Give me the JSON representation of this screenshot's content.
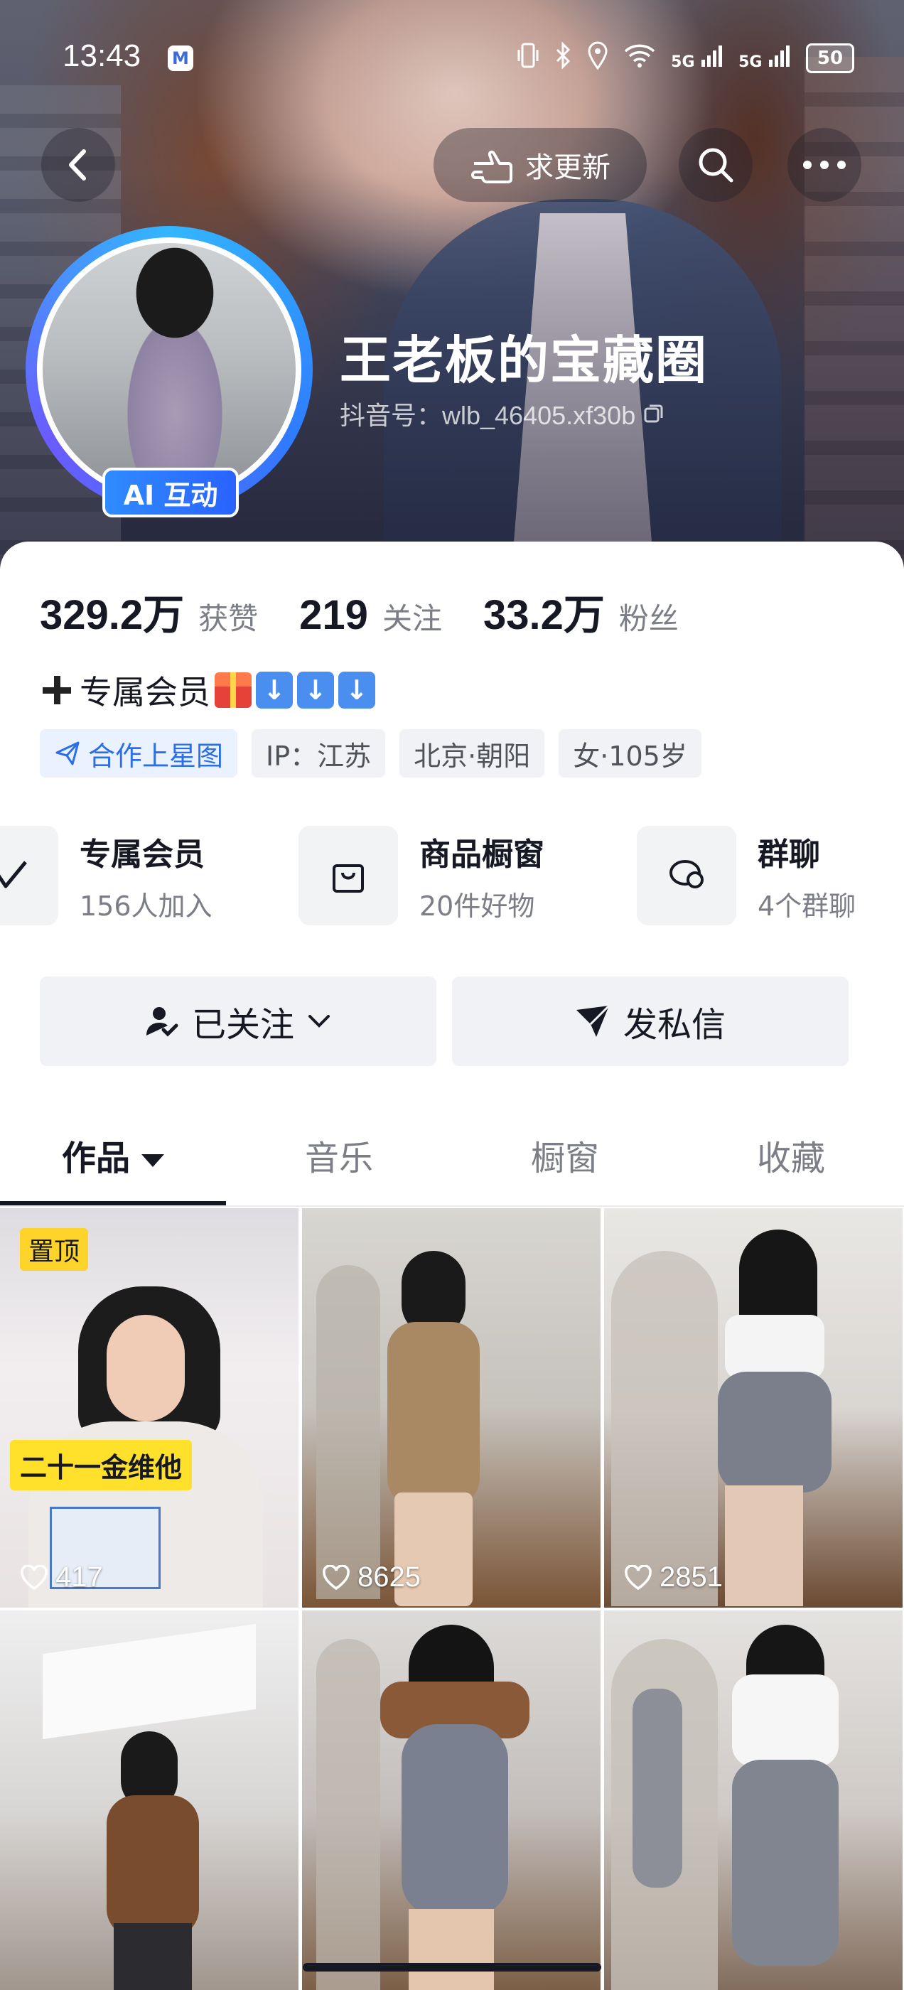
{
  "status_bar": {
    "time": "13:43",
    "app_badge": "M",
    "network_1": "5G",
    "network_2": "5G",
    "battery": "50"
  },
  "header": {
    "update_request_label": "求更新",
    "name": "王老板的宝藏圈",
    "douyin_id": "抖音号：wlb_46405.xf30b",
    "ai_badge": "AI 互动"
  },
  "stats": [
    {
      "value": "329.2万",
      "label": "获赞"
    },
    {
      "value": "219",
      "label": "关注"
    },
    {
      "value": "33.2万",
      "label": "粉丝"
    }
  ],
  "bio": {
    "text": "专属会员"
  },
  "tags": [
    {
      "label": "合作上星图"
    },
    {
      "label": "IP：江苏"
    },
    {
      "label": "北京·朝阳"
    },
    {
      "label": "女·105岁"
    }
  ],
  "features": [
    {
      "title": "专属会员",
      "subtitle": "156人加入"
    },
    {
      "title": "商品橱窗",
      "subtitle": "20件好物"
    },
    {
      "title": "群聊",
      "subtitle": "4个群聊"
    }
  ],
  "actions": {
    "follow_label": "已关注",
    "message_label": "发私信"
  },
  "tabs": [
    {
      "label": "作品",
      "active": true
    },
    {
      "label": "音乐",
      "active": false
    },
    {
      "label": "橱窗",
      "active": false
    },
    {
      "label": "收藏",
      "active": false
    }
  ],
  "videos": [
    {
      "likes": "417",
      "pinned_label": "置顶",
      "caption": "二十一金维他"
    },
    {
      "likes": "8625"
    },
    {
      "likes": "2851"
    },
    {
      "likes": ""
    },
    {
      "likes": ""
    },
    {
      "likes": ""
    }
  ],
  "colors": {
    "accent_blue": "#2b6ee8",
    "pin_yellow": "#ffd42a"
  }
}
